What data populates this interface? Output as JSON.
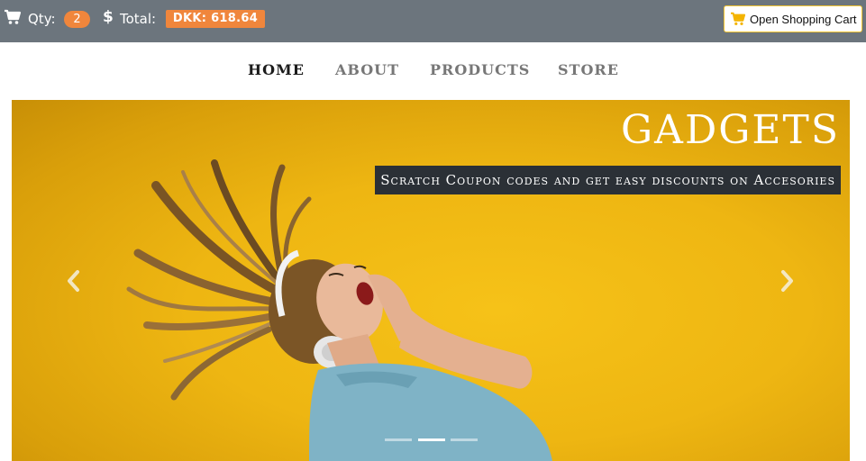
{
  "topbar": {
    "cart_icon": "shopping-cart-icon",
    "qty_label": "Qty:",
    "qty_value": "2",
    "dollar_icon": "dollar-icon",
    "dollar_glyph": "$",
    "total_label": "Total:",
    "total_value": "DKK: 618.64",
    "open_cart_label": "Open Shopping Cart",
    "badge_color": "#f0863c",
    "bar_color": "#6c757d"
  },
  "nav": {
    "items": [
      {
        "label": "HOME",
        "active": true
      },
      {
        "label": "ABOUT",
        "active": false
      },
      {
        "label": "PRODUCTS",
        "active": false
      },
      {
        "label": "STORE",
        "active": false
      }
    ]
  },
  "carousel": {
    "title": "GADGETS",
    "subtitle": "Scratch Coupon codes and get easy discounts on Accesories",
    "prev_icon": "chevron-left-icon",
    "next_icon": "chevron-right-icon",
    "indicators": [
      {
        "active": false
      },
      {
        "active": true
      },
      {
        "active": false
      }
    ],
    "background_color": "#eeb612"
  }
}
